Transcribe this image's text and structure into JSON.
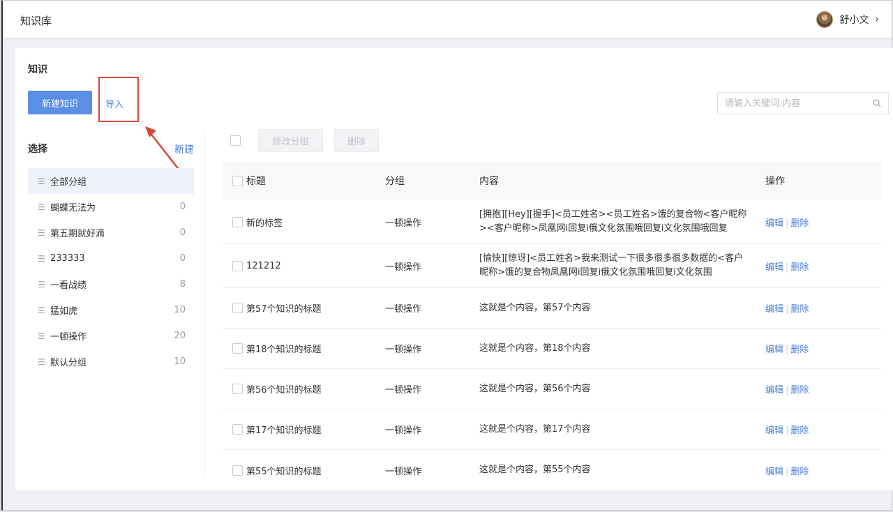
{
  "header": {
    "app_title": "知识库",
    "user_name": "舒小文",
    "chevron": "›"
  },
  "main": {
    "section_title": "知识",
    "new_button": "新建知识",
    "import_link": "导入",
    "search_placeholder": "请输入关键词,内容",
    "annotation_color": "#d9493a"
  },
  "groups": {
    "title": "选择",
    "new_label": "新建",
    "items": [
      {
        "name": "全部分组",
        "count": ""
      },
      {
        "name": "蝴蝶无法为",
        "count": "0"
      },
      {
        "name": "第五期就好滴",
        "count": "0"
      },
      {
        "name": "233333",
        "count": "0"
      },
      {
        "name": "一看战绩",
        "count": "8"
      },
      {
        "name": "猛如虎",
        "count": "10"
      },
      {
        "name": "一顿操作",
        "count": "20"
      },
      {
        "name": "默认分组",
        "count": "10"
      }
    ]
  },
  "toolbar": {
    "modify_group": "修改分组",
    "delete": "删除"
  },
  "table": {
    "headers": {
      "title": "标题",
      "group": "分组",
      "content": "内容",
      "ops": "操作"
    },
    "edit_label": "编辑",
    "delete_label": "删除",
    "rows": [
      {
        "title": "新的标签",
        "group": "一顿操作",
        "content": "[拥抱][Hey][握手]<员工姓名><员工姓名>饿的复合物<客户昵称><客户昵称>凤凰网i回复i俄文化氛围哦回复i文化氛围哦回复"
      },
      {
        "title": "121212",
        "group": "一顿操作",
        "content": "[愉快][惊讶]<员工姓名>我来测试一下很多很多很多数据的<客户昵称>饿的复合物凤凰网i回复i俄文化氛围哦回复i文化氛围"
      },
      {
        "title": "第57个知识的标题",
        "group": "一顿操作",
        "content": "这就是个内容，第57个内容"
      },
      {
        "title": "第18个知识的标题",
        "group": "一顿操作",
        "content": "这就是个内容，第18个内容"
      },
      {
        "title": "第56个知识的标题",
        "group": "一顿操作",
        "content": "这就是个内容，第56个内容"
      },
      {
        "title": "第17个知识的标题",
        "group": "一顿操作",
        "content": "这就是个内容，第17个内容"
      },
      {
        "title": "第55个知识的标题",
        "group": "一顿操作",
        "content": "这就是个内容，第55个内容"
      }
    ]
  },
  "icons": {
    "group_icon": "hamburger-icon",
    "search_icon": "search-icon",
    "annotation_arrow": "red-arrow-annotation"
  }
}
